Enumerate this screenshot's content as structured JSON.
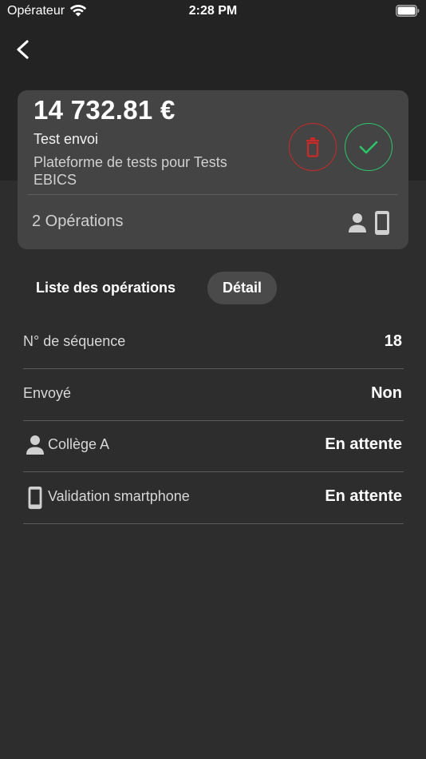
{
  "status_bar": {
    "carrier": "Opérateur",
    "time": "2:28 PM"
  },
  "card": {
    "amount": "14 732.81 €",
    "title": "Test envoi",
    "subtitle": "Plateforme de tests pour Tests EBICS",
    "operations_count": "2 Opérations"
  },
  "tabs": [
    {
      "label": "Liste des opérations",
      "selected": false
    },
    {
      "label": "Détail",
      "selected": true
    }
  ],
  "details": [
    {
      "label": "N° de séquence",
      "value": "18",
      "icon": ""
    },
    {
      "label": "Envoyé",
      "value": "Non",
      "icon": ""
    },
    {
      "label": "Collège A",
      "value": "En attente",
      "icon": "person-icon"
    },
    {
      "label": "Validation smartphone",
      "value": "En attente",
      "icon": "smartphone-icon"
    }
  ],
  "colors": {
    "background": "#2d2d2d",
    "card": "#444444",
    "delete": "#c82a2a",
    "validate": "#2ec26a"
  }
}
